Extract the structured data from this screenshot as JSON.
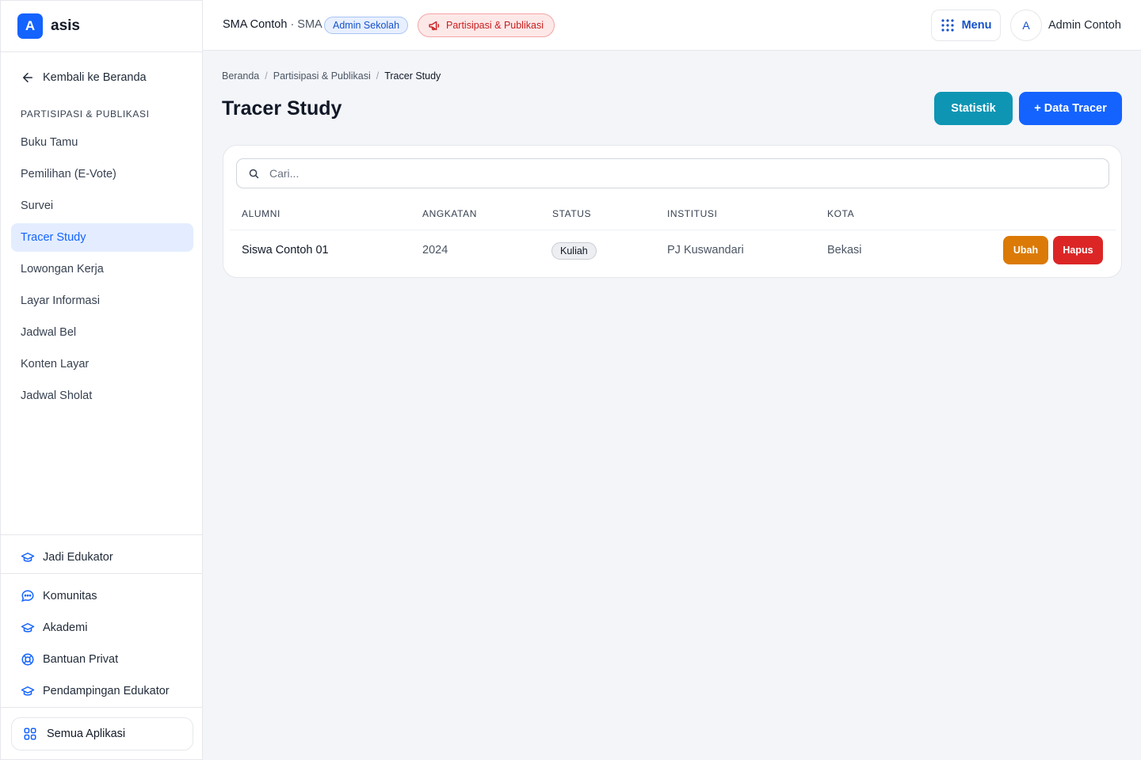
{
  "app": {
    "logo_letter": "A",
    "logo_text": "asis"
  },
  "sidebar": {
    "back_label": "Kembali ke Beranda",
    "section_title": "PARTISIPASI & PUBLIKASI",
    "items": [
      {
        "label": "Buku Tamu"
      },
      {
        "label": "Pemilihan (E-Vote)"
      },
      {
        "label": "Survei"
      },
      {
        "label": "Tracer Study",
        "active": true
      },
      {
        "label": "Lowongan Kerja"
      },
      {
        "label": "Layar Informasi"
      },
      {
        "label": "Jadwal Bel"
      },
      {
        "label": "Konten Layar"
      },
      {
        "label": "Jadwal Sholat"
      }
    ],
    "educator_label": "Jadi Edukator",
    "extras": [
      {
        "label": "Komunitas",
        "icon": "chat-icon"
      },
      {
        "label": "Akademi",
        "icon": "graduation-cap-icon"
      },
      {
        "label": "Bantuan Privat",
        "icon": "lifebuoy-icon"
      },
      {
        "label": "Pendampingan Edukator",
        "icon": "graduation-cap-icon"
      }
    ],
    "all_apps_label": "Semua Aplikasi"
  },
  "topbar": {
    "school_name": "SMA Contoh",
    "school_level": " · SMA",
    "role_badge": "Admin Sekolah",
    "module_badge": "Partisipasi & Publikasi",
    "menu_label": "Menu",
    "avatar_letter": "A",
    "user_name": "Admin Contoh"
  },
  "breadcrumb": {
    "home": "Beranda",
    "section": "Partisipasi & Publikasi",
    "current": "Tracer Study",
    "separator": "/"
  },
  "page": {
    "title": "Tracer Study",
    "stat_button": "Statistik",
    "add_button": "+ Data Tracer"
  },
  "table": {
    "search_placeholder": "Cari...",
    "headers": {
      "alumni": "ALUMNI",
      "angkatan": "ANGKATAN",
      "status": "STATUS",
      "institusi": "INSTITUSI",
      "kota": "KOTA"
    },
    "rows": [
      {
        "alumni": "Siswa Contoh 01",
        "angkatan": "2024",
        "status": "Kuliah",
        "institusi": "PJ Kuswandari",
        "kota": "Bekasi",
        "edit_label": "Ubah",
        "delete_label": "Hapus"
      }
    ]
  },
  "colors": {
    "primary": "#1463ff",
    "teal": "#0e95b4",
    "orange": "#db7a06",
    "red": "#dc2626"
  }
}
